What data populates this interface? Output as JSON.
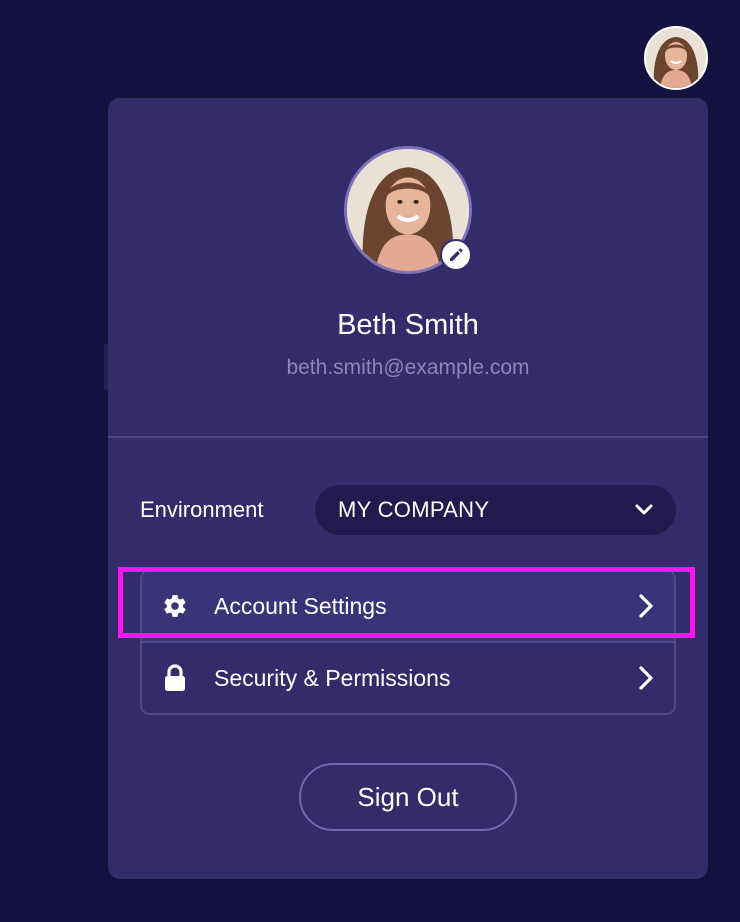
{
  "header": {
    "avatar_icon": "user-avatar-photo"
  },
  "profile": {
    "name": "Beth Smith",
    "email": "beth.smith@example.com",
    "edit_icon": "pencil-icon"
  },
  "environment": {
    "label": "Environment",
    "selected": "MY COMPANY",
    "dropdown_icon": "chevron-down-icon"
  },
  "menu": {
    "items": [
      {
        "label": "Account Settings",
        "icon": "gear-icon",
        "chevron": "chevron-right-icon",
        "highlighted": true
      },
      {
        "label": "Security & Permissions",
        "icon": "lock-icon",
        "chevron": "chevron-right-icon",
        "highlighted": false
      }
    ]
  },
  "actions": {
    "sign_out": "Sign Out"
  },
  "colors": {
    "background": "#16123f",
    "panel": "#342c6a",
    "select_bg": "#211b4f",
    "highlight": "#ff14f0",
    "email_text": "#8d86b6"
  }
}
